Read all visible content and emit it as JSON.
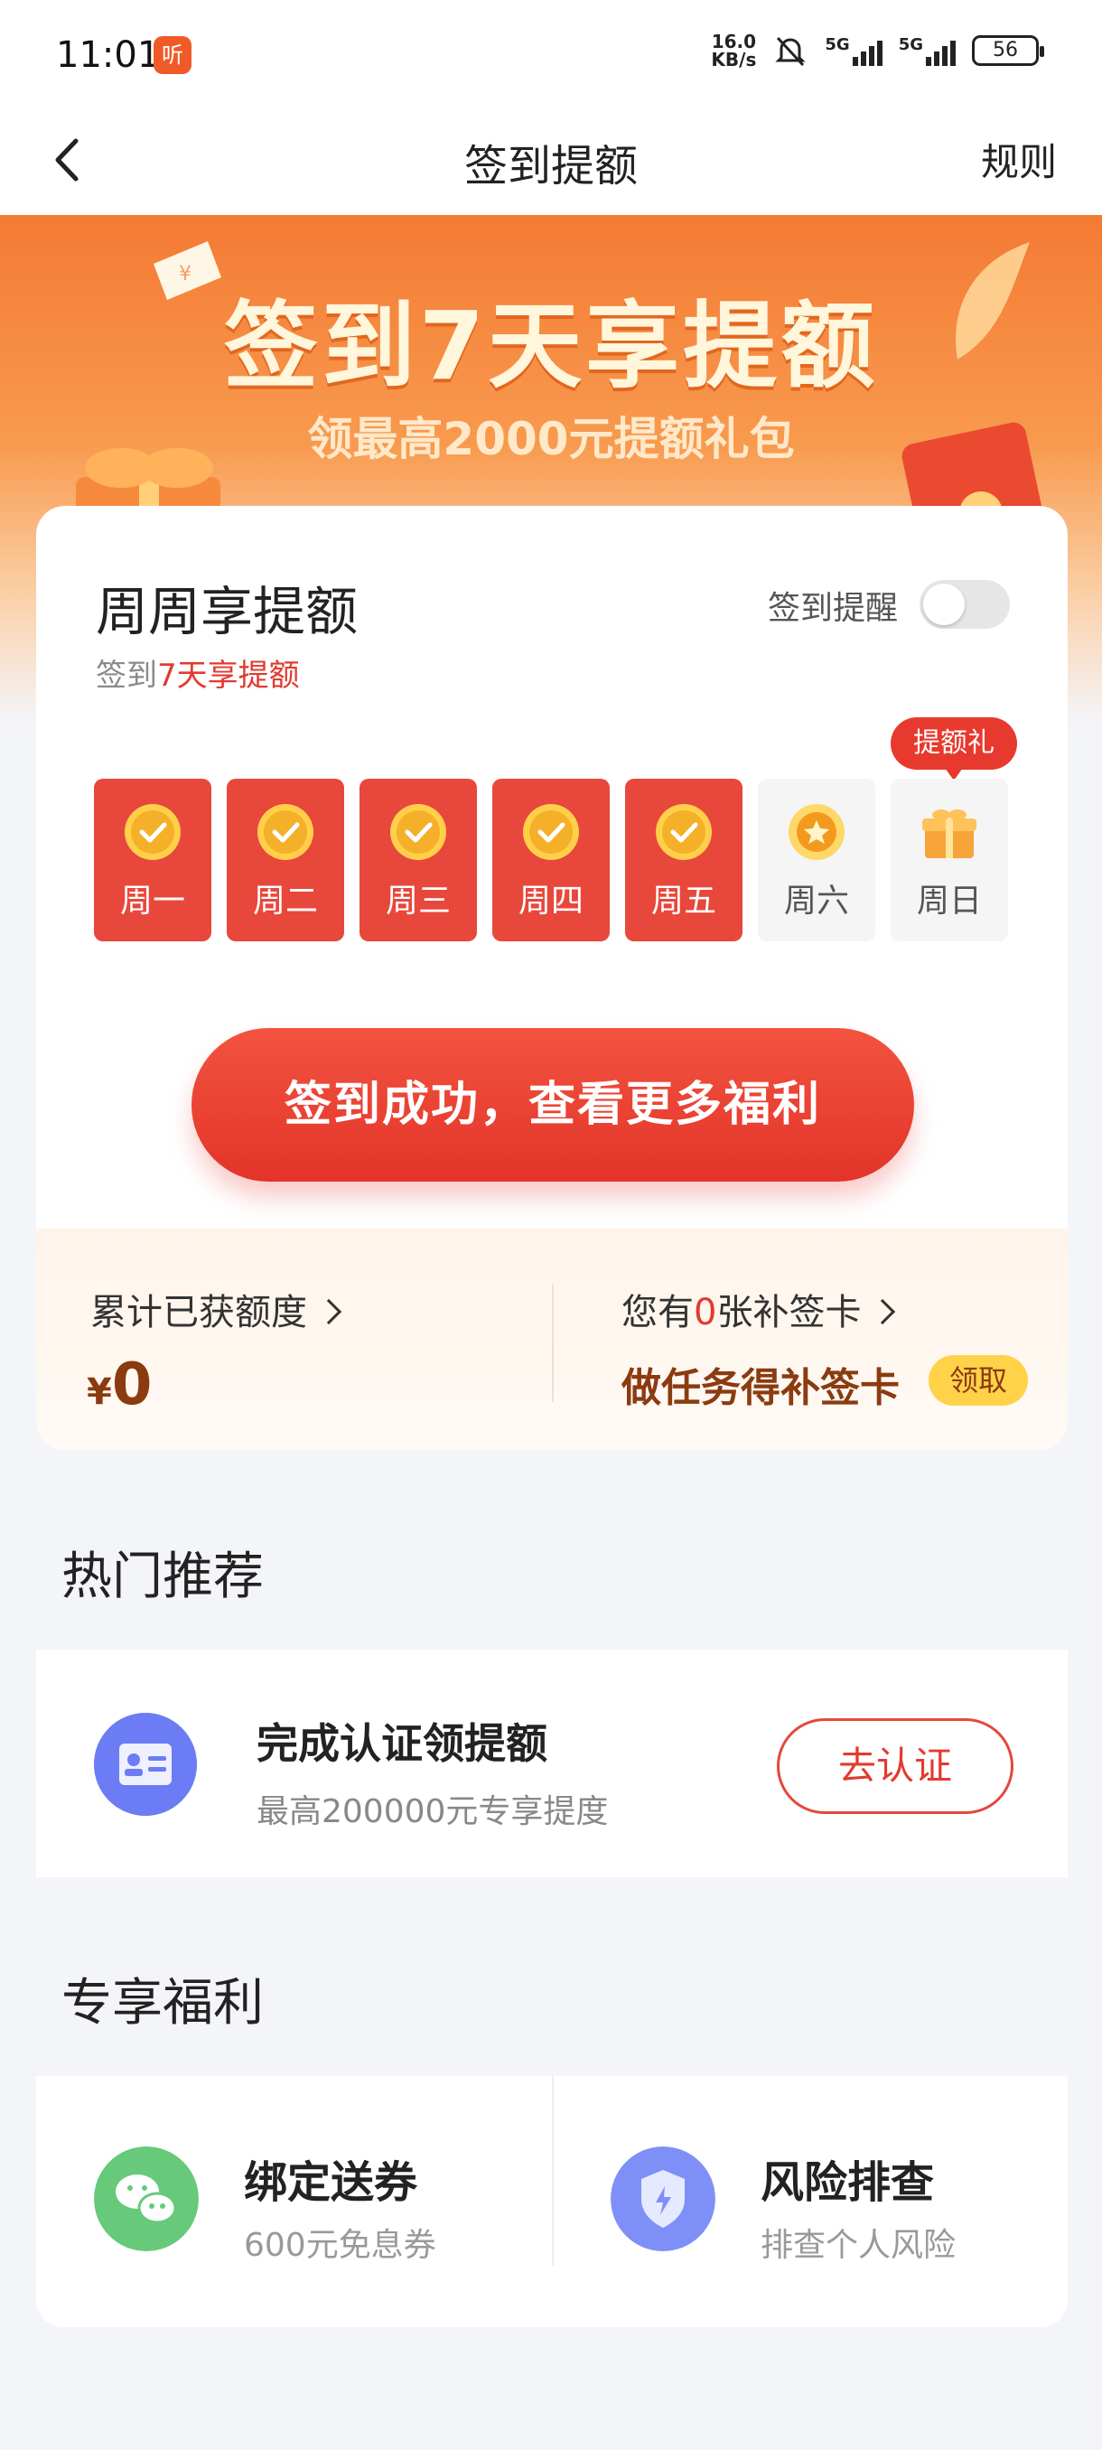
{
  "status_bar": {
    "time": "11:01",
    "app_badge": "听",
    "net_speed_top": "16.0",
    "net_speed_bottom": "KB/s",
    "sim1": "5G",
    "sim2": "5G",
    "battery": "56"
  },
  "nav": {
    "title": "签到提额",
    "rules": "规则"
  },
  "banner": {
    "title": "签到7天享提额",
    "subtitle": "领最高2000元提额礼包"
  },
  "checkin": {
    "title": "周周享提额",
    "subtitle_prefix": "签到",
    "subtitle_highlight": "7天享提额",
    "remind_label": "签到提醒",
    "remind_on": false,
    "gift_tag": "提额礼",
    "days": [
      {
        "label": "周一",
        "state": "checked"
      },
      {
        "label": "周二",
        "state": "checked"
      },
      {
        "label": "周三",
        "state": "checked"
      },
      {
        "label": "周四",
        "state": "checked"
      },
      {
        "label": "周五",
        "state": "checked"
      },
      {
        "label": "周六",
        "state": "pending"
      },
      {
        "label": "周日",
        "state": "gift"
      }
    ],
    "button": "签到成功，查看更多福利",
    "accumulated_label": "累计已获额度",
    "currency": "¥",
    "accumulated_value": "0",
    "cards_prefix": "您有",
    "cards_count": "0",
    "cards_suffix": "张补签卡",
    "task_label": "做任务得补签卡",
    "claim_button": "领取"
  },
  "hot": {
    "section_title": "热门推荐",
    "item_title": "完成认证领提额",
    "item_sub": "最高200000元专享提度",
    "item_button": "去认证"
  },
  "benefits": {
    "section_title": "专享福利",
    "items": [
      {
        "title": "绑定送券",
        "sub": "600元免息券",
        "icon": "wechat-icon",
        "color": "#67c97a"
      },
      {
        "title": "风险排查",
        "sub": "排查个人风险",
        "icon": "shield-icon",
        "color": "#7e90f7"
      }
    ]
  },
  "colors": {
    "accent_red": "#e8473b",
    "banner_orange": "#f47a34",
    "brown_text": "#8b3b10",
    "claim_yellow": "#ffd24a"
  }
}
